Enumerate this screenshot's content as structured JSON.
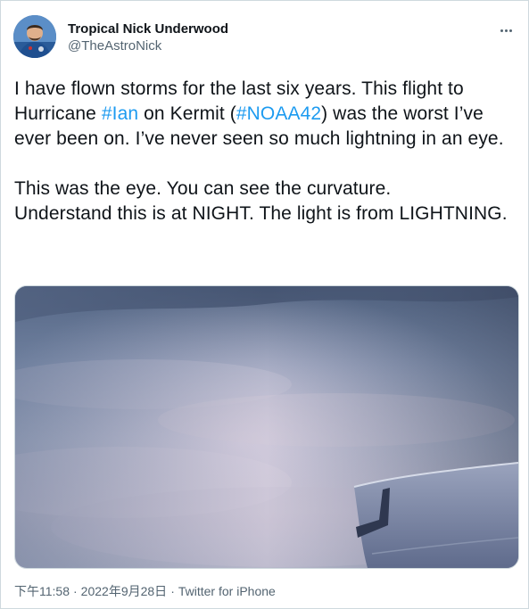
{
  "author": {
    "display_name": "Tropical Nick Underwood",
    "handle": "@TheAstroNick"
  },
  "tweet": {
    "p1_part1": "I have flown storms for the last six years. This flight to Hurricane ",
    "p1_hashtag1": "#Ian",
    "p1_part2": " on Kermit (",
    "p1_hashtag2": "#NOAA42",
    "p1_part3": ") was the worst I’ve ever been on. I’ve never seen so much lightning in an eye.",
    "p2_line1": "This was the eye. You can see the curvature.",
    "p2_line2": "Understand this is at NIGHT. The light is from LIGHTNING."
  },
  "meta": {
    "time": "下午11:58",
    "separator": "·",
    "date": "2022年9月28日",
    "source": "Twitter for iPhone"
  },
  "colors": {
    "link": "#1d9bf0",
    "text": "#0f1419",
    "secondary": "#536471",
    "border": "#cfd9de"
  },
  "icons": {
    "more": "more-icon",
    "avatar": "avatar-photo"
  }
}
